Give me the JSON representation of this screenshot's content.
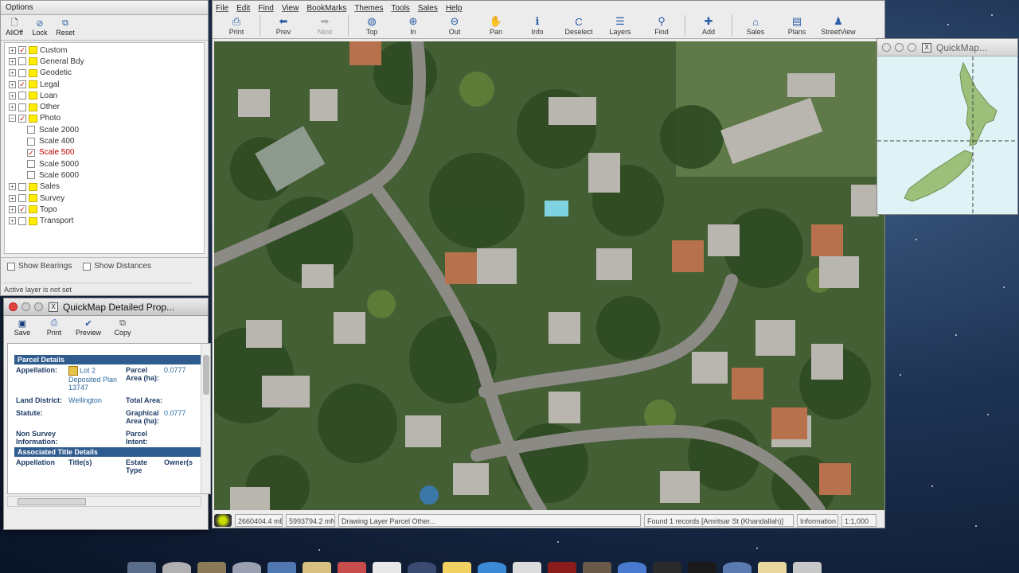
{
  "options_panel": {
    "title": "Options",
    "toolbar": [
      {
        "label": "AllOff",
        "icon": "document-icon"
      },
      {
        "label": "Lock",
        "icon": "lock-icon"
      },
      {
        "label": "Reset",
        "icon": "reset-icon"
      }
    ],
    "tree": [
      {
        "label": "Custom",
        "checked": true,
        "expanded": false
      },
      {
        "label": "General Bdy",
        "checked": false,
        "expanded": false
      },
      {
        "label": "Geodetic",
        "checked": false,
        "expanded": false
      },
      {
        "label": "Legal",
        "checked": true,
        "expanded": false
      },
      {
        "label": "Loan",
        "checked": false,
        "expanded": false
      },
      {
        "label": "Other",
        "checked": false,
        "expanded": false
      },
      {
        "label": "Photo",
        "checked": true,
        "expanded": true,
        "children": [
          {
            "label": "Scale 2000",
            "checked": false
          },
          {
            "label": "Scale 400",
            "checked": false
          },
          {
            "label": "Scale 500",
            "checked": true
          },
          {
            "label": "Scale 5000",
            "checked": false
          },
          {
            "label": "Scale 6000",
            "checked": false
          }
        ]
      },
      {
        "label": "Sales",
        "checked": false,
        "expanded": false
      },
      {
        "label": "Survey",
        "checked": false,
        "expanded": false
      },
      {
        "label": "Topo",
        "checked": true,
        "expanded": false
      },
      {
        "label": "Transport",
        "checked": false,
        "expanded": false
      }
    ],
    "show_bearings": "Show Bearings",
    "show_distances": "Show Distances",
    "status": "Active layer is not set"
  },
  "detail_window": {
    "title": "QuickMap Detailed Prop...",
    "toolbar": [
      {
        "label": "Save",
        "icon": "save-icon"
      },
      {
        "label": "Print",
        "icon": "print-icon"
      },
      {
        "label": "Preview",
        "icon": "preview-icon"
      },
      {
        "label": "Copy",
        "icon": "copy-icon"
      }
    ],
    "parcel_details_heading": "Parcel Details",
    "appellation_key": "Appellation:",
    "appellation_value": "Lot 2 Deposited Plan 13747",
    "parcel_area_key": "Parcel Area (ha):",
    "parcel_area_value": "0.0777",
    "land_district_key": "Land District:",
    "land_district_value": "Wellington",
    "total_area_key": "Total Area:",
    "statute_key": "Statute:",
    "graphical_area_key": "Graphical Area (ha):",
    "graphical_area_value": "0.0777",
    "non_survey_key": "Non Survey Information:",
    "parcel_intent_key": "Parcel Intent:",
    "title_details_heading": "Associated Title Details",
    "title_columns": [
      "Appellation",
      "Title(s)",
      "Estate Type",
      "Owner(s"
    ]
  },
  "main_window": {
    "menu": [
      "File",
      "Edit",
      "Find",
      "View",
      "BookMarks",
      "Themes",
      "Tools",
      "Sales",
      "Help"
    ],
    "toolbar": [
      {
        "label": "Print",
        "icon": "print-icon",
        "glyph": "⎙",
        "enabled": true
      },
      {
        "sep": true
      },
      {
        "label": "Prev",
        "icon": "arrow-left-icon",
        "glyph": "⬅",
        "enabled": true
      },
      {
        "label": "Next",
        "icon": "arrow-right-icon",
        "glyph": "➡",
        "enabled": false
      },
      {
        "sep": true
      },
      {
        "label": "Top",
        "icon": "globe-icon",
        "glyph": "◍",
        "enabled": true
      },
      {
        "label": "In",
        "icon": "zoom-in-icon",
        "glyph": "⊕",
        "enabled": true
      },
      {
        "label": "Out",
        "icon": "zoom-out-icon",
        "glyph": "⊖",
        "enabled": true
      },
      {
        "label": "Pan",
        "icon": "hand-icon",
        "glyph": "✋",
        "enabled": true
      },
      {
        "label": "Info",
        "icon": "info-icon",
        "glyph": "ℹ",
        "enabled": true
      },
      {
        "label": "Deselect",
        "icon": "deselect-icon",
        "glyph": "C",
        "enabled": true
      },
      {
        "label": "Layers",
        "icon": "layers-icon",
        "glyph": "☰",
        "enabled": true
      },
      {
        "label": "Find",
        "icon": "binoculars-icon",
        "glyph": "⚲",
        "enabled": true
      },
      {
        "sep": true
      },
      {
        "label": "Add",
        "icon": "add-icon",
        "glyph": "✚",
        "enabled": true
      },
      {
        "sep": true
      },
      {
        "label": "Sales",
        "icon": "house-icon",
        "glyph": "⌂",
        "enabled": true
      },
      {
        "label": "Plans",
        "icon": "plans-icon",
        "glyph": "▤",
        "enabled": true
      },
      {
        "label": "StreetView",
        "icon": "pegman-icon",
        "glyph": "♟",
        "enabled": true
      }
    ],
    "status": {
      "easting": "2660404.4 mE",
      "northing": "5993794.2 mN",
      "message": "Drawing Layer Parcel Other...",
      "records": "Found 1 records [Amritsar St (Khandallah)]",
      "mode": "Information",
      "scale": "1:1,000"
    }
  },
  "overview_window": {
    "title": "QuickMap..."
  }
}
